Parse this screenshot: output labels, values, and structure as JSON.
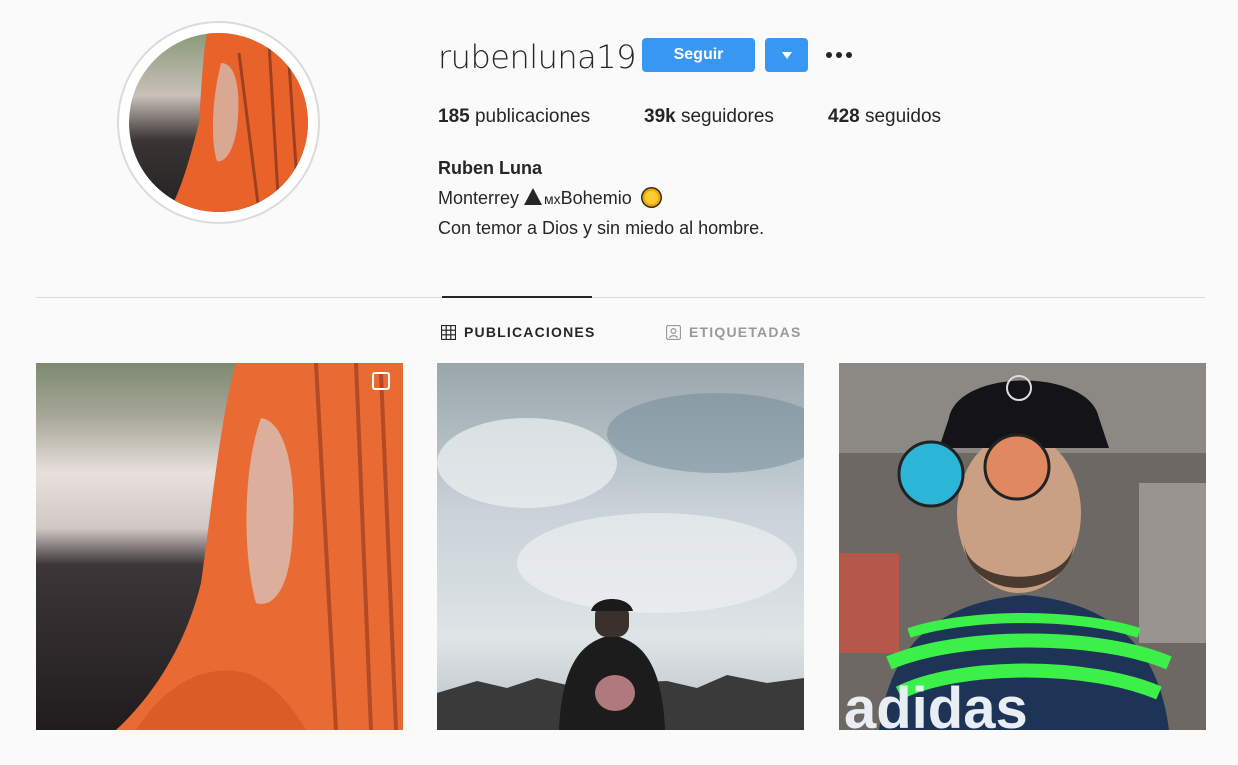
{
  "profile": {
    "username": "rubenluna19",
    "follow_label": "Seguir",
    "stats": {
      "posts_count": "185",
      "posts_label": "publicaciones",
      "followers_count": "39k",
      "followers_label": "seguidores",
      "following_count": "428",
      "following_label": "seguidos"
    },
    "full_name": "Ruben Luna",
    "bio_line1_before": "Monterrey ",
    "bio_line1_mx": "мх",
    "bio_line1_after": "Bohemio",
    "bio_line2": "Con temor a Dios y sin miedo al hombre."
  },
  "tabs": [
    {
      "label": "PUBLICACIONES",
      "icon": "grid-icon",
      "active": true
    },
    {
      "label": "ETIQUETADAS",
      "icon": "tag-person-icon",
      "active": false
    }
  ],
  "colors": {
    "accent": "#3897f0",
    "background": "#fafafa",
    "text": "#262626",
    "muted": "#999999",
    "divider": "#dbdbdb"
  }
}
